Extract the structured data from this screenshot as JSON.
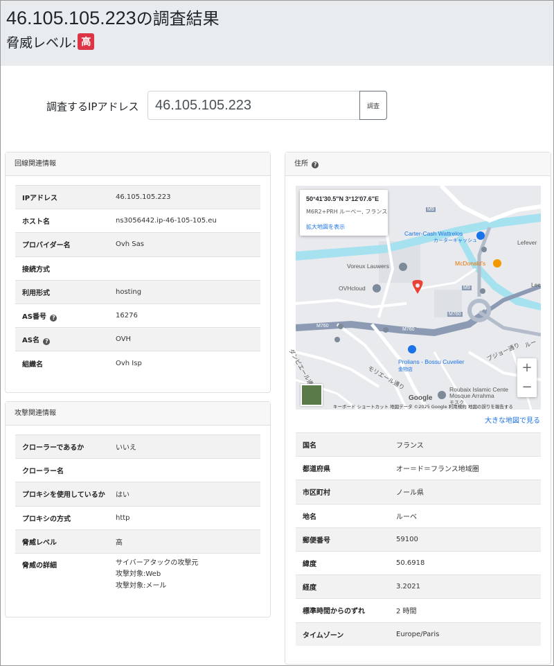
{
  "page": {
    "title_ip": "46.105.105.223",
    "title_suffix": "の調査結果",
    "threat_label": "脅威レベル:",
    "threat_badge": "高"
  },
  "search": {
    "label": "調査するIPアドレス",
    "value": "46.105.105.223",
    "button": "調査"
  },
  "line_info": {
    "header": "回線関連情報",
    "rows": [
      {
        "k": "IPアドレス",
        "v": "46.105.105.223"
      },
      {
        "k": "ホスト名",
        "v": "ns3056442.ip-46-105-105.eu"
      },
      {
        "k": "プロバイダー名",
        "v": "Ovh Sas"
      },
      {
        "k": "接続方式",
        "v": ""
      },
      {
        "k": "利用形式",
        "v": "hosting"
      },
      {
        "k": "AS番号",
        "v": "16276"
      },
      {
        "k": "AS名",
        "v": "OVH"
      },
      {
        "k": "組織名",
        "v": "Ovh Isp"
      }
    ]
  },
  "attack_info": {
    "header": "攻撃関連情報",
    "rows": [
      {
        "k": "クローラーであるか",
        "v": "いいえ"
      },
      {
        "k": "クローラー名",
        "v": ""
      },
      {
        "k": "プロキシを使用しているか",
        "v": "はい"
      },
      {
        "k": "プロキシの方式",
        "v": "http"
      },
      {
        "k": "脅威レベル",
        "v": "高"
      },
      {
        "k": "脅威の詳細",
        "v1": "サイバーアタックの攻撃元",
        "v2": "攻撃対象:Web",
        "v3": "攻撃対象:メール"
      }
    ]
  },
  "address": {
    "header": "住所",
    "map": {
      "coords": "50°41'30.5\"N 3°12'07.6\"E",
      "plus_code": "M6R2+PRH ルーベー, フランス",
      "enlarge_link": "拡大地図を表示",
      "big_map_link": "大きな地図で見る",
      "attribution": "キーボード ショートカット   地図データ ©2025 Google   利用規約   地図の誤りを報告する",
      "labels": {
        "carter": "Carter-Cash Wattrelos",
        "carter_jp": "カーターキャッシュ",
        "mcd": "McDonald's",
        "voreux": "Voreux Lauwers",
        "ovh": "OVHcloud",
        "prolians": "Prolians - Bossu Cuvelier",
        "prolians_jp": "金物店",
        "roubaix": "Roubaix Islamic Cente",
        "mosque": "Mosque Arrahma",
        "mosque_jp": "モスク",
        "lefever": "Lefever",
        "lec": "Lec",
        "m9a": "M9",
        "m9b": "M9",
        "m760a": "M760",
        "m760b": "M760",
        "m760c": "M760",
        "road1": "ダンピエール通り",
        "road2": "モリエール通り",
        "road3": "ブジョー通り",
        "road4": "ルー",
        "google": "Google",
        "zoom_in": "+",
        "zoom_out": "−"
      },
      "colors": {
        "water": "#a6e1f0",
        "road": "#ffffff",
        "highway": "#8c9bb3",
        "pin": "#ea4335"
      }
    },
    "rows": [
      {
        "k": "国名",
        "v": "フランス"
      },
      {
        "k": "都道府県",
        "v": "オー＝ド＝フランス地域圏"
      },
      {
        "k": "市区町村",
        "v": "ノール県"
      },
      {
        "k": "地名",
        "v": "ルーベ"
      },
      {
        "k": "郵便番号",
        "v": "59100"
      },
      {
        "k": "緯度",
        "v": "50.6918"
      },
      {
        "k": "経度",
        "v": "3.2021"
      },
      {
        "k": "標準時間からのずれ",
        "v": "2 時間"
      },
      {
        "k": "タイムゾーン",
        "v": "Europe/Paris"
      }
    ]
  }
}
